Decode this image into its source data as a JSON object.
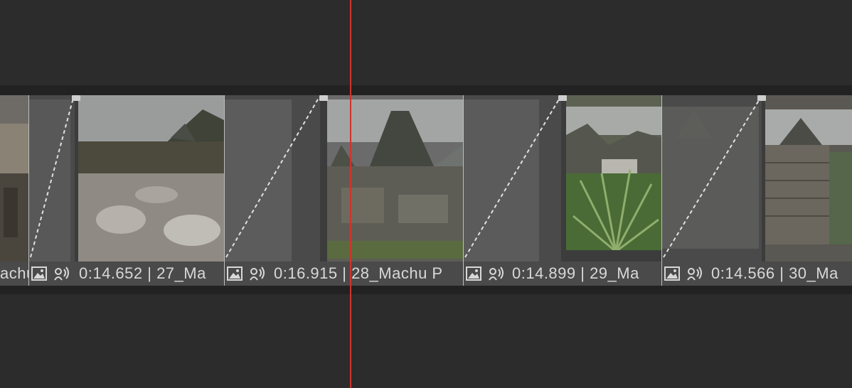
{
  "timeline": {
    "labels": [
      {
        "text": "achu"
      },
      {
        "text": "0:14.652 | 27_Ma"
      },
      {
        "text": "0:16.915 | 28_Machu P"
      },
      {
        "text": "0:14.899 | 29_Ma"
      },
      {
        "text": "0:14.566 | 30_Ma"
      }
    ],
    "colors": {
      "playhead": "#d0342c",
      "track": "#3c3c3c",
      "label_bar": "#4a4a4a"
    }
  },
  "icons": [
    "image-icon",
    "audio-icon"
  ]
}
